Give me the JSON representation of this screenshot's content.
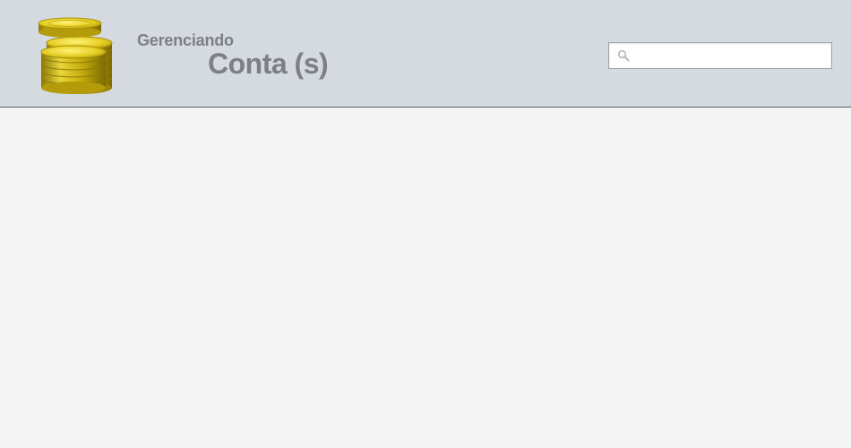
{
  "header": {
    "title_small": "Gerenciando",
    "title_big": "Conta (s)",
    "logo_icon": "coins-stack-icon"
  },
  "search": {
    "placeholder": "",
    "value": "",
    "icon": "search-icon"
  },
  "colors": {
    "header_bg": "#d5d9e0",
    "title": "#7c7f85",
    "page_bg": "#f4f4f4",
    "coin_gold": "#d8c21a"
  }
}
